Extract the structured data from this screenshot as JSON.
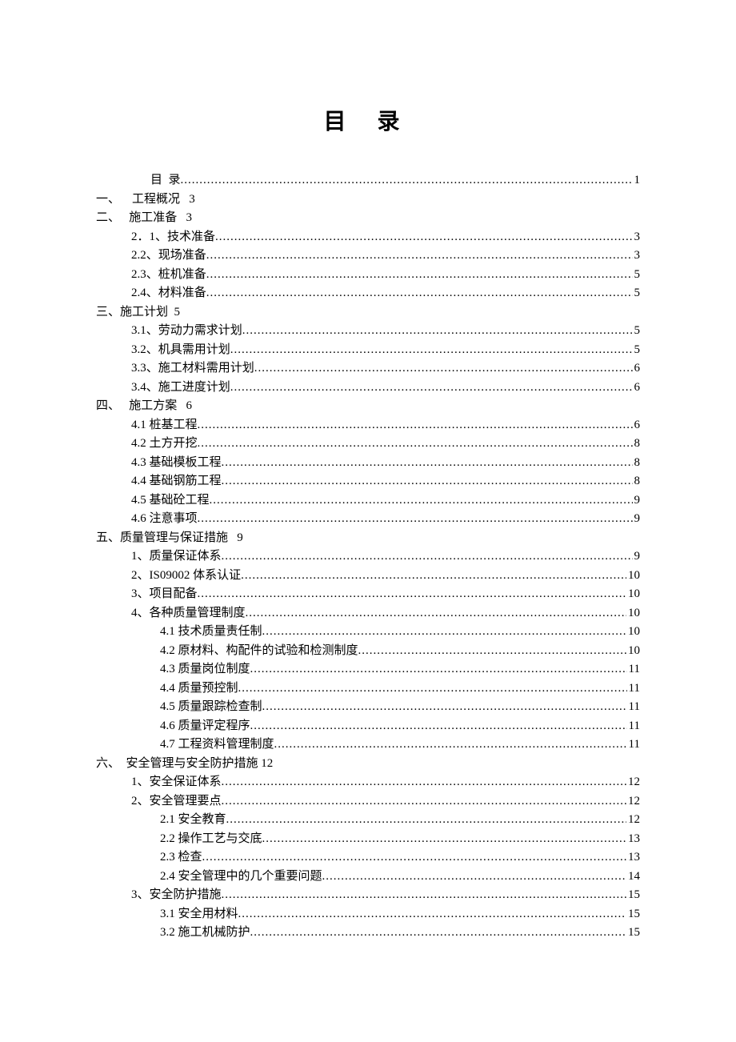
{
  "title": "目  录",
  "entries": [
    {
      "level": "firstline",
      "label": "目  录",
      "page": "1",
      "dots": true
    },
    {
      "level": "l0",
      "label": "一、    工程概况   3",
      "page": "",
      "dots": false
    },
    {
      "level": "l0",
      "label": "二、   施工准备   3",
      "page": "",
      "dots": false
    },
    {
      "level": "l1",
      "label": "2．1、技术准备",
      "page": "3",
      "dots": true
    },
    {
      "level": "l1",
      "label": "2.2、现场准备",
      "page": "3",
      "dots": true
    },
    {
      "level": "l1",
      "label": "2.3、桩机准备",
      "page": "5",
      "dots": true
    },
    {
      "level": "l1",
      "label": "2.4、材料准备",
      "page": "5",
      "dots": true
    },
    {
      "level": "l0",
      "label": "三、施工计划  5",
      "page": "",
      "dots": false
    },
    {
      "level": "l1",
      "label": "3.1、劳动力需求计划",
      "page": "5",
      "dots": true
    },
    {
      "level": "l1",
      "label": "3.2、机具需用计划",
      "page": "5",
      "dots": true
    },
    {
      "level": "l1",
      "label": "3.3、施工材料需用计划",
      "page": "6",
      "dots": true
    },
    {
      "level": "l1",
      "label": "3.4、施工进度计划",
      "page": "6",
      "dots": true
    },
    {
      "level": "l0",
      "label": "四、   施工方案   6",
      "page": "",
      "dots": false
    },
    {
      "level": "l1",
      "label": "4.1 桩基工程",
      "page": "6",
      "dots": true
    },
    {
      "level": "l1",
      "label": "4.2 土方开挖",
      "page": "8",
      "dots": true
    },
    {
      "level": "l1",
      "label": "4.3 基础模板工程",
      "page": "8",
      "dots": true
    },
    {
      "level": "l1",
      "label": "4.4 基础钢筋工程",
      "page": "8",
      "dots": true
    },
    {
      "level": "l1",
      "label": "4.5 基础砼工程",
      "page": "9",
      "dots": true
    },
    {
      "level": "l1",
      "label": "4.6 注意事项",
      "page": "9",
      "dots": true
    },
    {
      "level": "l0",
      "label": "五、质量管理与保证措施   9",
      "page": "",
      "dots": false
    },
    {
      "level": "l1",
      "label": "1、质量保证体系",
      "page": "9",
      "dots": true
    },
    {
      "level": "l1",
      "label": "2、IS09002 体系认证",
      "page": "10",
      "dots": true
    },
    {
      "level": "l1",
      "label": "3、项目配备",
      "page": "10",
      "dots": true
    },
    {
      "level": "l1",
      "label": "4、各种质量管理制度",
      "page": "10",
      "dots": true
    },
    {
      "level": "l2",
      "label": "4.1 技术质量责任制",
      "page": "10",
      "dots": true
    },
    {
      "level": "l2",
      "label": "4.2 原材料、构配件的试验和检测制度",
      "page": "10",
      "dots": true
    },
    {
      "level": "l2",
      "label": "4.3 质量岗位制度",
      "page": "11",
      "dots": true
    },
    {
      "level": "l2",
      "label": "4.4 质量预控制",
      "page": "11",
      "dots": true
    },
    {
      "level": "l2",
      "label": "4.5 质量跟踪检查制",
      "page": "11",
      "dots": true
    },
    {
      "level": "l2",
      "label": "4.6 质量评定程序",
      "page": "11",
      "dots": true
    },
    {
      "level": "l2",
      "label": "4.7 工程资料管理制度",
      "page": "11",
      "dots": true
    },
    {
      "level": "l0",
      "label": "六、  安全管理与安全防护措施 12",
      "page": "",
      "dots": false
    },
    {
      "level": "l1",
      "label": "1、安全保证体系",
      "page": "12",
      "dots": true
    },
    {
      "level": "l1",
      "label": "2、安全管理要点",
      "page": "12",
      "dots": true
    },
    {
      "level": "l2",
      "label": "2.1 安全教育",
      "page": "12",
      "dots": true
    },
    {
      "level": "l2",
      "label": "2.2 操作工艺与交底",
      "page": "13",
      "dots": true
    },
    {
      "level": "l2",
      "label": "2.3 检查",
      "page": "13",
      "dots": true
    },
    {
      "level": "l2",
      "label": "2.4 安全管理中的几个重要问题",
      "page": "14",
      "dots": true
    },
    {
      "level": "l1",
      "label": "3、安全防护措施",
      "page": "15",
      "dots": true
    },
    {
      "level": "l2",
      "label": "3.1 安全用材料",
      "page": "15",
      "dots": true
    },
    {
      "level": "l2",
      "label": "3.2 施工机械防护",
      "page": "15",
      "dots": true
    }
  ]
}
